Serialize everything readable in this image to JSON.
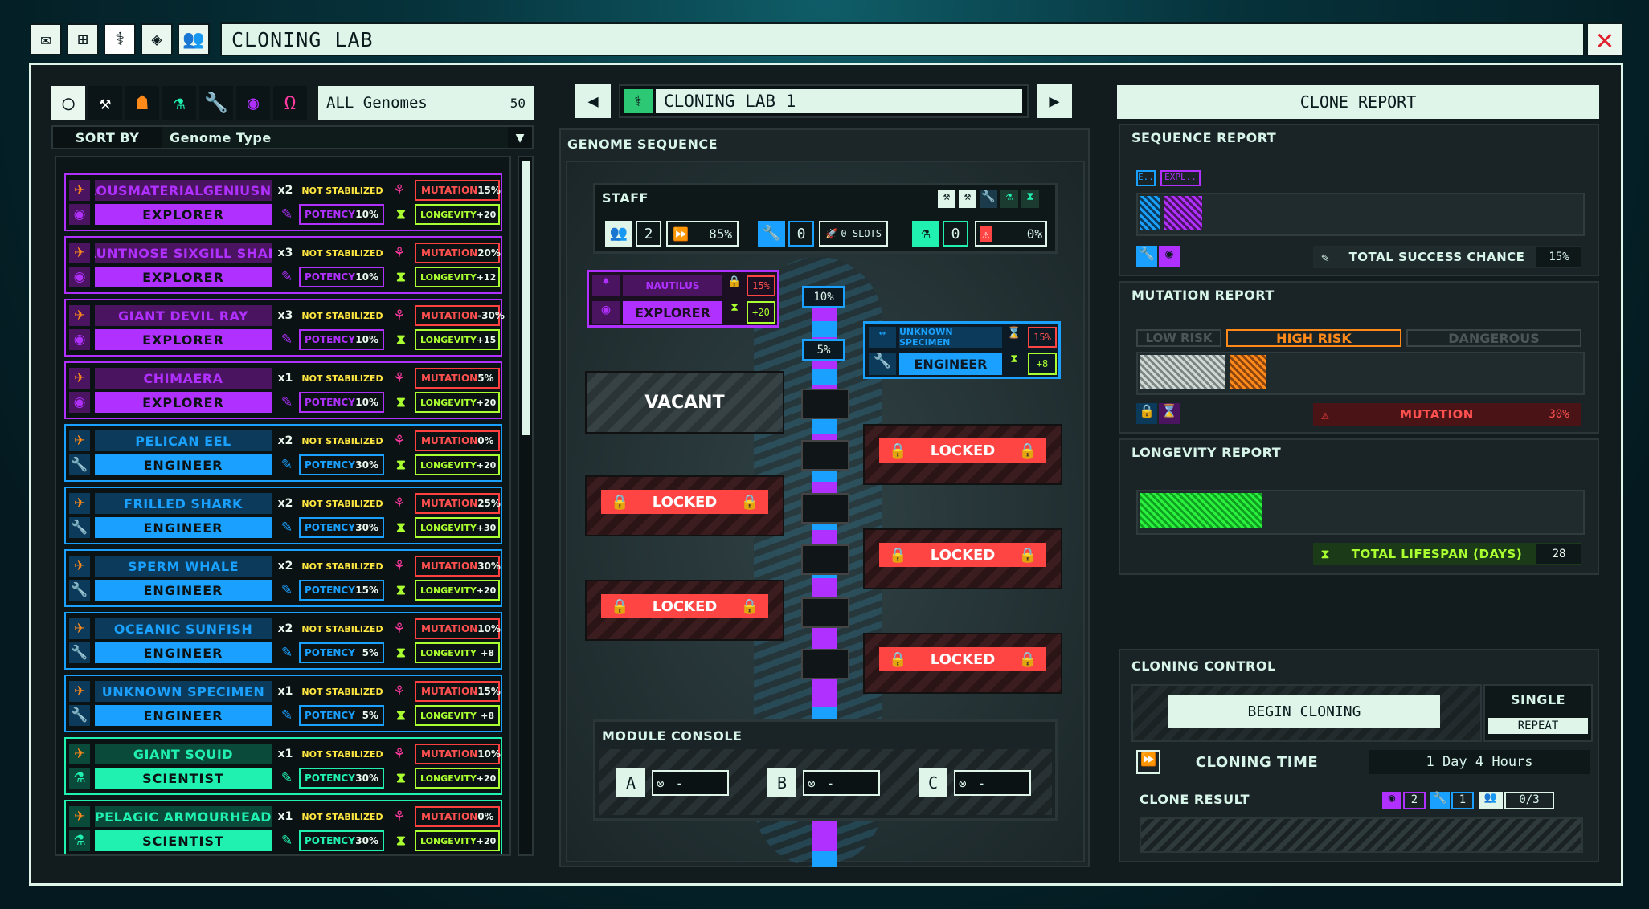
{
  "window": {
    "title": "CLONING LAB"
  },
  "topbar_icons": [
    "mail-icon",
    "tree-icon",
    "dna-icon",
    "diamond-icon",
    "crew-icon"
  ],
  "filter": {
    "label": "ALL Genomes",
    "count": "50",
    "sort_by_label": "SORT BY",
    "sort_value": "Genome Type"
  },
  "genomes": [
    {
      "name": "_ANOMALOUSMATERIALGENIUSNAMETEXT",
      "count": "x2",
      "status": "NOT STABILIZED",
      "class": "EXPLORER",
      "potency": "POTENCY",
      "potency_val": "10%",
      "mutation": "MUTATION",
      "mutation_val": "15%",
      "longevity": "LONGEVITY",
      "longevity_val": "+20",
      "color": "#b030ff",
      "name_bg": "#4a1460"
    },
    {
      "name": "BLUNTNOSE SIXGILL SHARK",
      "count": "x3",
      "status": "NOT STABILIZED",
      "class": "EXPLORER",
      "potency": "POTENCY",
      "potency_val": "10%",
      "mutation": "MUTATION",
      "mutation_val": "20%",
      "longevity": "LONGEVITY",
      "longevity_val": "+12",
      "color": "#b030ff",
      "name_bg": "#4a1460"
    },
    {
      "name": "GIANT DEVIL RAY",
      "count": "x3",
      "status": "NOT STABILIZED",
      "class": "EXPLORER",
      "potency": "POTENCY",
      "potency_val": "10%",
      "mutation": "MUTATION",
      "mutation_val": "-30%",
      "longevity": "LONGEVITY",
      "longevity_val": "+15",
      "color": "#b030ff",
      "name_bg": "#4a1460"
    },
    {
      "name": "CHIMAERA",
      "count": "x1",
      "status": "NOT STABILIZED",
      "class": "EXPLORER",
      "potency": "POTENCY",
      "potency_val": "10%",
      "mutation": "MUTATION",
      "mutation_val": "5%",
      "longevity": "LONGEVITY",
      "longevity_val": "+20",
      "color": "#b030ff",
      "name_bg": "#4a1460"
    },
    {
      "name": "PELICAN EEL",
      "count": "x2",
      "status": "NOT STABILIZED",
      "class": "ENGINEER",
      "potency": "POTENCY",
      "potency_val": "30%",
      "mutation": "MUTATION",
      "mutation_val": "0%",
      "longevity": "LONGEVITY",
      "longevity_val": "+20",
      "color": "#1aa0ff",
      "name_bg": "#0b3a5a"
    },
    {
      "name": "FRILLED SHARK",
      "count": "x2",
      "status": "NOT STABILIZED",
      "class": "ENGINEER",
      "potency": "POTENCY",
      "potency_val": "30%",
      "mutation": "MUTATION",
      "mutation_val": "25%",
      "longevity": "LONGEVITY",
      "longevity_val": "+30",
      "color": "#1aa0ff",
      "name_bg": "#0b3a5a"
    },
    {
      "name": "SPERM WHALE",
      "count": "x2",
      "status": "NOT STABILIZED",
      "class": "ENGINEER",
      "potency": "POTENCY",
      "potency_val": "15%",
      "mutation": "MUTATION",
      "mutation_val": "30%",
      "longevity": "LONGEVITY",
      "longevity_val": "+20",
      "color": "#1aa0ff",
      "name_bg": "#0b3a5a"
    },
    {
      "name": "OCEANIC SUNFISH",
      "count": "x2",
      "status": "NOT STABILIZED",
      "class": "ENGINEER",
      "potency": "POTENCY",
      "potency_val": "5%",
      "mutation": "MUTATION",
      "mutation_val": "10%",
      "longevity": "LONGEVITY",
      "longevity_val": "+8",
      "color": "#1aa0ff",
      "name_bg": "#0b3a5a"
    },
    {
      "name": "UNKNOWN SPECIMEN",
      "count": "x1",
      "status": "NOT STABILIZED",
      "class": "ENGINEER",
      "potency": "POTENCY",
      "potency_val": "5%",
      "mutation": "MUTATION",
      "mutation_val": "15%",
      "longevity": "LONGEVITY",
      "longevity_val": "+8",
      "color": "#1aa0ff",
      "name_bg": "#0b3a5a"
    },
    {
      "name": "GIANT SQUID",
      "count": "x1",
      "status": "NOT STABILIZED",
      "class": "SCIENTIST",
      "potency": "POTENCY",
      "potency_val": "30%",
      "mutation": "MUTATION",
      "mutation_val": "10%",
      "longevity": "LONGEVITY",
      "longevity_val": "+20",
      "color": "#20f0b0",
      "name_bg": "#0a4a3a"
    },
    {
      "name": "PELAGIC ARMOURHEAD",
      "count": "x1",
      "status": "NOT STABILIZED",
      "class": "SCIENTIST",
      "potency": "POTENCY",
      "potency_val": "30%",
      "mutation": "MUTATION",
      "mutation_val": "0%",
      "longevity": "LONGEVITY",
      "longevity_val": "+20",
      "color": "#20f0b0",
      "name_bg": "#0a4a3a"
    }
  ],
  "lab": {
    "name": "CLONING LAB 1",
    "genome_sequence": "GENOME SEQUENCE"
  },
  "staff": {
    "label": "STAFF",
    "crew": "2",
    "speed": "85%",
    "engineer": "0",
    "slots": "0 SLOTS",
    "scientist": "0",
    "hazard": "0%"
  },
  "slot1": {
    "name": "NAUTILUS",
    "class": "EXPLORER",
    "mutation": "15%",
    "longevity": "+20",
    "link": "10%"
  },
  "slot2": {
    "name": "UNKNOWN SPECIMEN",
    "class": "ENGINEER",
    "mutation": "15%",
    "longevity": "+8",
    "link": "5%"
  },
  "vacant": "VACANT",
  "locked": "LOCKED",
  "module": {
    "label": "MODULE CONSOLE",
    "slots": [
      {
        "key": "A",
        "val": "-"
      },
      {
        "key": "B",
        "val": "-"
      },
      {
        "key": "C",
        "val": "-"
      }
    ]
  },
  "report": {
    "title": "CLONE REPORT",
    "sequence_label": "SEQUENCE REPORT",
    "seq_tags": [
      "E..",
      "EXPL.."
    ],
    "success_label": "TOTAL SUCCESS CHANCE",
    "success_val": "15%",
    "success_fraction": 0.15,
    "mutation_label": "MUTATION REPORT",
    "risk_low": "LOW RISK",
    "risk_high": "HIGH RISK",
    "risk_danger": "DANGEROUS",
    "mutation_text": "MUTATION",
    "mutation_val": "30%",
    "mutation_fraction": 0.3,
    "longevity_label": "LONGEVITY REPORT",
    "lifespan_label": "TOTAL LIFESPAN (DAYS)",
    "lifespan_val": "28",
    "lifespan_fraction": 0.28
  },
  "control": {
    "title": "CLONING CONTROL",
    "begin": "BEGIN CLONING",
    "single": "SINGLE",
    "repeat": "REPEAT",
    "time_label": "CLONING TIME",
    "time_val": "1 Day 4 Hours",
    "result_label": "CLONE RESULT",
    "res_explorer": "2",
    "res_engineer": "1",
    "res_crew": "0/3"
  },
  "colors": {
    "explorer": "#b030ff",
    "engineer": "#1aa0ff",
    "scientist": "#20f0b0",
    "danger": "#ff4444",
    "longevity": "#aaff30",
    "accent": "#dff5ea"
  }
}
